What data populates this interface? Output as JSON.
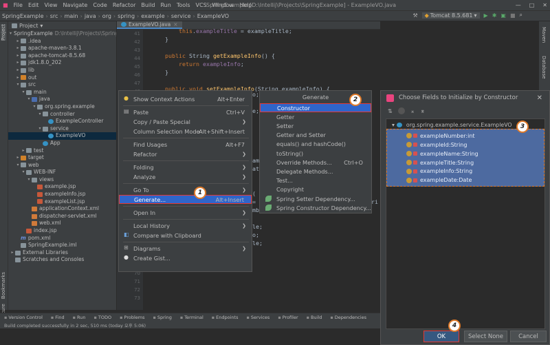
{
  "menubar": {
    "items": [
      "File",
      "Edit",
      "View",
      "Navigate",
      "Code",
      "Refactor",
      "Build",
      "Run",
      "Tools",
      "VCS",
      "Window",
      "Help"
    ],
    "window_title": "SpringExample [D:\\Intellij\\Projects\\SpringExample] - ExampleVO.java"
  },
  "navbar": {
    "crumbs": [
      "SpringExample",
      "src",
      "main",
      "java",
      "org",
      "spring",
      "example",
      "service",
      "ExampleVO"
    ],
    "run_config": "Tomcat 8.5.681"
  },
  "project": {
    "header": "Project",
    "tree": [
      {
        "label": "SpringExample",
        "extra": "D:\\Intellij\\Projects\\SpringExam",
        "indent": 0,
        "arrow": "▾",
        "icon": "fld"
      },
      {
        "label": ".idea",
        "indent": 1,
        "arrow": "▸",
        "icon": "fld"
      },
      {
        "label": "apache-maven-3.8.1",
        "indent": 1,
        "arrow": "▸",
        "icon": "fld"
      },
      {
        "label": "apache-tomcat-8.5.68",
        "indent": 1,
        "arrow": "▸",
        "icon": "fld"
      },
      {
        "label": "jdk1.8.0_202",
        "indent": 1,
        "arrow": "▸",
        "icon": "fld"
      },
      {
        "label": "lib",
        "indent": 1,
        "arrow": "▸",
        "icon": "fld"
      },
      {
        "label": "out",
        "indent": 1,
        "arrow": "▸",
        "icon": "fldo"
      },
      {
        "label": "src",
        "indent": 1,
        "arrow": "▾",
        "icon": "fld"
      },
      {
        "label": "main",
        "indent": 2,
        "arrow": "▾",
        "icon": "fld"
      },
      {
        "label": "java",
        "indent": 3,
        "arrow": "▾",
        "icon": "fldb"
      },
      {
        "label": "org.spring.example",
        "indent": 4,
        "arrow": "▾",
        "icon": "fld"
      },
      {
        "label": "controller",
        "indent": 5,
        "arrow": "▾",
        "icon": "fld"
      },
      {
        "label": "ExampleController",
        "indent": 6,
        "arrow": "",
        "icon": "cls"
      },
      {
        "label": "service",
        "indent": 5,
        "arrow": "▾",
        "icon": "fld"
      },
      {
        "label": "ExampleVO",
        "indent": 6,
        "arrow": "",
        "icon": "cls",
        "selected": true
      },
      {
        "label": "App",
        "indent": 5,
        "arrow": "",
        "icon": "cls"
      },
      {
        "label": "test",
        "indent": 2,
        "arrow": "▸",
        "icon": "fld"
      },
      {
        "label": "target",
        "indent": 1,
        "arrow": "▸",
        "icon": "fldo"
      },
      {
        "label": "web",
        "indent": 1,
        "arrow": "▾",
        "icon": "fld"
      },
      {
        "label": "WEB-INF",
        "indent": 2,
        "arrow": "▾",
        "icon": "fld"
      },
      {
        "label": "views",
        "indent": 3,
        "arrow": "▾",
        "icon": "fld"
      },
      {
        "label": "example.jsp",
        "indent": 4,
        "arrow": "",
        "icon": "jsp"
      },
      {
        "label": "exampleInfo.jsp",
        "indent": 4,
        "arrow": "",
        "icon": "jsp"
      },
      {
        "label": "exampleList.jsp",
        "indent": 4,
        "arrow": "",
        "icon": "jsp"
      },
      {
        "label": "applicationContext.xml",
        "indent": 3,
        "arrow": "",
        "icon": "xml"
      },
      {
        "label": "dispatcher-servlet.xml",
        "indent": 3,
        "arrow": "",
        "icon": "xml"
      },
      {
        "label": "web.xml",
        "indent": 3,
        "arrow": "",
        "icon": "xml"
      },
      {
        "label": "index.jsp",
        "indent": 2,
        "arrow": "",
        "icon": "jsp"
      },
      {
        "label": "pom.xml",
        "indent": 1,
        "arrow": "",
        "icon": "m"
      },
      {
        "label": "SpringExample.iml",
        "indent": 1,
        "arrow": "",
        "icon": "fld"
      },
      {
        "label": "External Libraries",
        "indent": 0,
        "arrow": "▸",
        "icon": "fld"
      },
      {
        "label": "Scratches and Consoles",
        "indent": 0,
        "arrow": "",
        "icon": "fld"
      }
    ]
  },
  "editor": {
    "tab": "ExampleVO.java",
    "line_numbers": [
      "41",
      "42",
      "43",
      "44",
      "45",
      "46",
      "47",
      "48",
      "49",
      "50",
      "51",
      "52",
      "53",
      "54",
      "55",
      "56",
      "57",
      "58",
      "59",
      "60",
      "61",
      "62",
      "63",
      "64",
      "65",
      "66",
      "67",
      "68",
      "69",
      "70",
      "71",
      "72",
      "73"
    ],
    "lines": [
      {
        "html": "        <span class='kw'>this</span>.<span class='fd'>exampleTitle</span> = exampleTitle;"
      },
      {
        "html": "    }"
      },
      {
        "html": ""
      },
      {
        "html": "    <span class='kw'>public</span> String <span class='fn'>getExampleInfo</span>() {"
      },
      {
        "html": "        <span class='kw'>return</span> <span class='fd'>exampleInfo</span>;"
      },
      {
        "html": "    }"
      },
      {
        "html": ""
      },
      {
        "html": "    <span class='kw'>public void</span> <span class='fn'>setExampleInfo</span>(String exampleInfo) {"
      }
    ],
    "fragments": [
      "o;",
      "e;",
      "amp",
      "ate",
      "(",
      "= ",
      "mbe",
      "le;",
      "o;",
      "le;"
    ],
    "fragment_extra": "tri"
  },
  "context_menu": {
    "items": [
      {
        "label": "Show Context Actions",
        "shortcut": "Alt+Enter",
        "icon": "bulb"
      },
      {
        "sep": true
      },
      {
        "label": "Paste",
        "shortcut": "Ctrl+V",
        "icon": "paste"
      },
      {
        "label": "Copy / Paste Special",
        "sub": true
      },
      {
        "label": "Column Selection Mode",
        "shortcut": "Alt+Shift+Insert"
      },
      {
        "sep": true
      },
      {
        "label": "Find Usages",
        "shortcut": "Alt+F7"
      },
      {
        "label": "Refactor",
        "sub": true
      },
      {
        "sep": true
      },
      {
        "label": "Folding",
        "sub": true
      },
      {
        "label": "Analyze",
        "sub": true
      },
      {
        "sep": true
      },
      {
        "label": "Go To",
        "sub": true
      },
      {
        "label": "Generate...",
        "shortcut": "Alt+Insert",
        "highlight": true
      },
      {
        "sep": true
      },
      {
        "label": "Open In",
        "sub": true
      },
      {
        "sep": true
      },
      {
        "label": "Local History",
        "sub": true
      },
      {
        "label": "Compare with Clipboard",
        "icon": "compare"
      },
      {
        "sep": true
      },
      {
        "label": "Diagrams",
        "sub": true,
        "icon": "diagram"
      },
      {
        "label": "Create Gist...",
        "icon": "github"
      }
    ]
  },
  "generate_menu": {
    "title": "Generate",
    "items": [
      {
        "label": "Constructor",
        "highlight": true
      },
      {
        "label": "Getter"
      },
      {
        "label": "Setter"
      },
      {
        "label": "Getter and Setter"
      },
      {
        "label": "equals() and hashCode()"
      },
      {
        "label": "toString()"
      },
      {
        "label": "Override Methods...",
        "shortcut": "Ctrl+O"
      },
      {
        "label": "Delegate Methods..."
      },
      {
        "label": "Test..."
      },
      {
        "label": "Copyright"
      },
      {
        "label": "Spring Setter Dependency...",
        "leaf": true
      },
      {
        "label": "Spring Constructor Dependency...",
        "leaf": true
      }
    ]
  },
  "dialog": {
    "title": "Choose Fields to Initialize by Constructor",
    "root": "org.spring.example.service.ExampleVO",
    "fields": [
      "exampleNumber:int",
      "exampleId:String",
      "exampleName:String",
      "exampleTitle:String",
      "exampleInfo:String",
      "exampleDate:Date"
    ],
    "ok": "OK",
    "select_none": "Select None",
    "cancel": "Cancel"
  },
  "bottom_tools": [
    "Version Control",
    "Find",
    "Run",
    "TODO",
    "Problems",
    "Spring",
    "Terminal",
    "Endpoints",
    "Services",
    "Profiler",
    "Build",
    "Dependencies"
  ],
  "status": "Build completed successfully in 2 sec, 510 ms (today 오후 5:06)",
  "side_labels": {
    "project": "Project",
    "bookmarks": "Bookmarks",
    "structure": "Structure",
    "maven": "Maven",
    "database": "Database"
  },
  "badges": [
    "1",
    "2",
    "3",
    "4"
  ],
  "colors": {
    "highlight": "#2f65ca",
    "annotation_red": "#e53935",
    "annotation_orange": "#e07b2a",
    "fields_bg": "#4d6aa0"
  }
}
